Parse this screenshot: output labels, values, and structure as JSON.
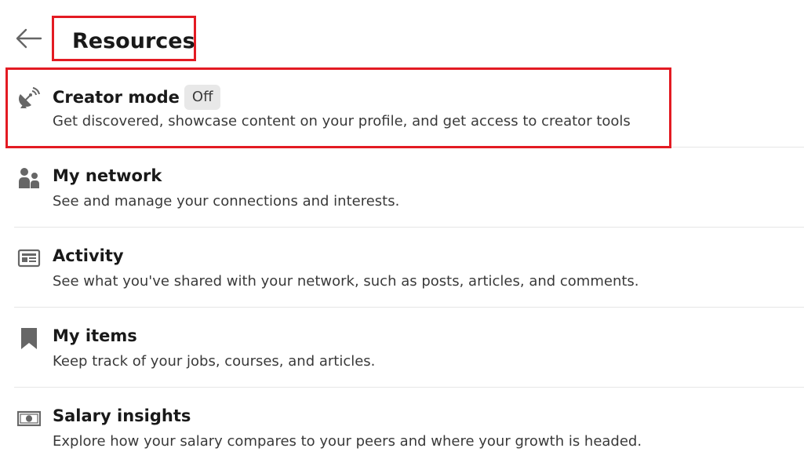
{
  "header": {
    "title": "Resources",
    "back_icon": "arrow-left-icon"
  },
  "items": [
    {
      "icon": "creator-mode-icon",
      "title": "Creator mode",
      "badge": "Off",
      "description": "Get discovered, showcase content on your profile, and get access to creator tools"
    },
    {
      "icon": "people-icon",
      "title": "My network",
      "description": "See and manage your connections and interests."
    },
    {
      "icon": "activity-icon",
      "title": "Activity",
      "description": "See what you've shared with your network, such as posts, articles, and comments."
    },
    {
      "icon": "bookmark-icon",
      "title": "My items",
      "description": "Keep track of your jobs, courses, and articles."
    },
    {
      "icon": "salary-icon",
      "title": "Salary insights",
      "description": "Explore how your salary compares to your peers and where your growth is headed."
    }
  ],
  "colors": {
    "highlight": "#e31b23",
    "icon": "#666666",
    "divider": "#e6e6e6",
    "badge_bg": "#e8e8e8"
  }
}
